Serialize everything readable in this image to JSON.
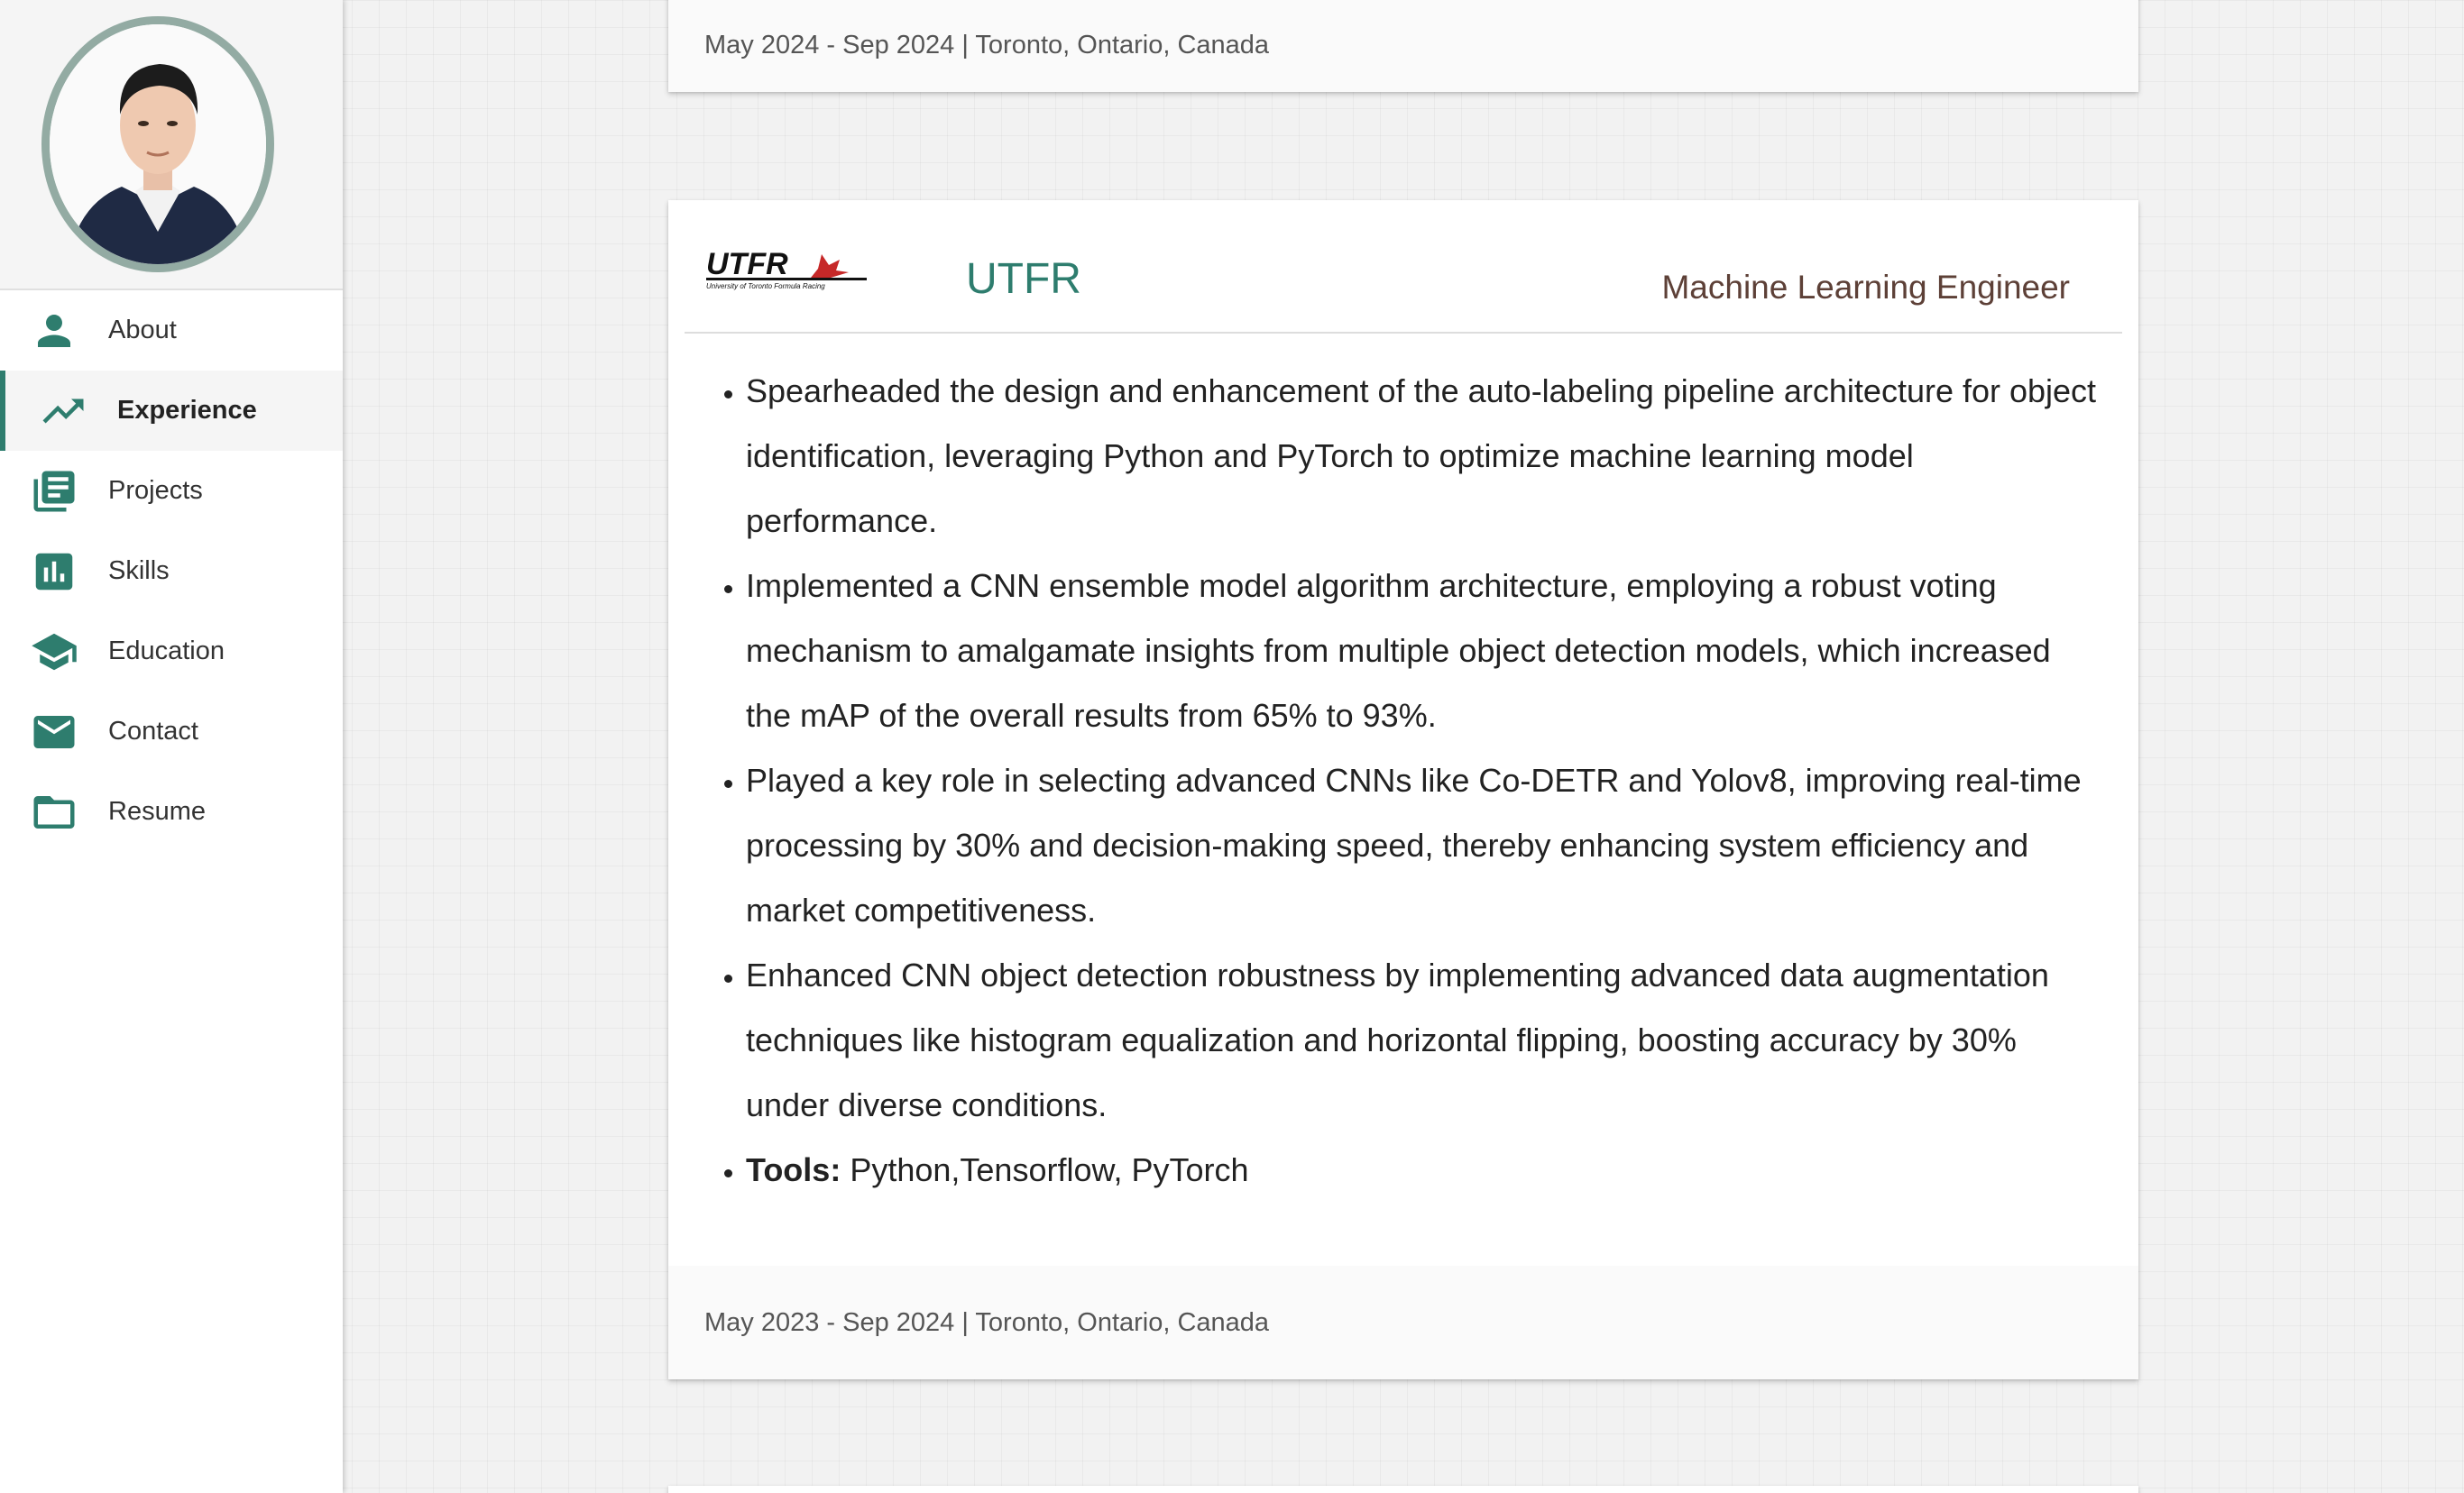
{
  "sidebar": {
    "items": [
      {
        "label": "About",
        "icon": "person-icon"
      },
      {
        "label": "Experience",
        "icon": "trending-up-icon"
      },
      {
        "label": "Projects",
        "icon": "library-books-icon"
      },
      {
        "label": "Skills",
        "icon": "bar-chart-icon"
      },
      {
        "label": "Education",
        "icon": "graduation-cap-icon"
      },
      {
        "label": "Contact",
        "icon": "mail-icon"
      },
      {
        "label": "Resume",
        "icon": "folder-icon"
      }
    ],
    "active": "Experience"
  },
  "previous_card": {
    "footer": "May 2024 - Sep 2024 | Toronto, Ontario, Canada"
  },
  "experience": {
    "logo_text": "UTFR",
    "logo_subtext": "University of Toronto Formula Racing",
    "company": "UTFR",
    "role": "Machine Learning Engineer",
    "bullets": [
      "Spearheaded the design and enhancement of the auto-labeling pipeline architecture for object identification, leveraging Python and PyTorch to optimize machine learning model performance.",
      "Implemented a CNN ensemble model algorithm architecture, employing a robust voting mechanism to amalgamate insights from multiple object detection models, which increased the mAP of the overall results from 65% to 93%.",
      "Played a key role in selecting advanced CNNs like Co-DETR and Yolov8, improving real-time processing by 30% and decision-making speed, thereby enhancing system efficiency and market competitiveness.",
      "Enhanced CNN object detection robustness by implementing advanced data augmentation techniques like histogram equalization and horizontal flipping, boosting accuracy by 30% under diverse conditions."
    ],
    "tools_label": "Tools:",
    "tools_value": " Python,Tensorflow, PyTorch",
    "footer": "May 2023 - Sep 2024 | Toronto, Ontario, Canada"
  },
  "colors": {
    "accent": "#2e7d6e",
    "role": "#5d4037",
    "avatar_ring": "#93aba3"
  }
}
